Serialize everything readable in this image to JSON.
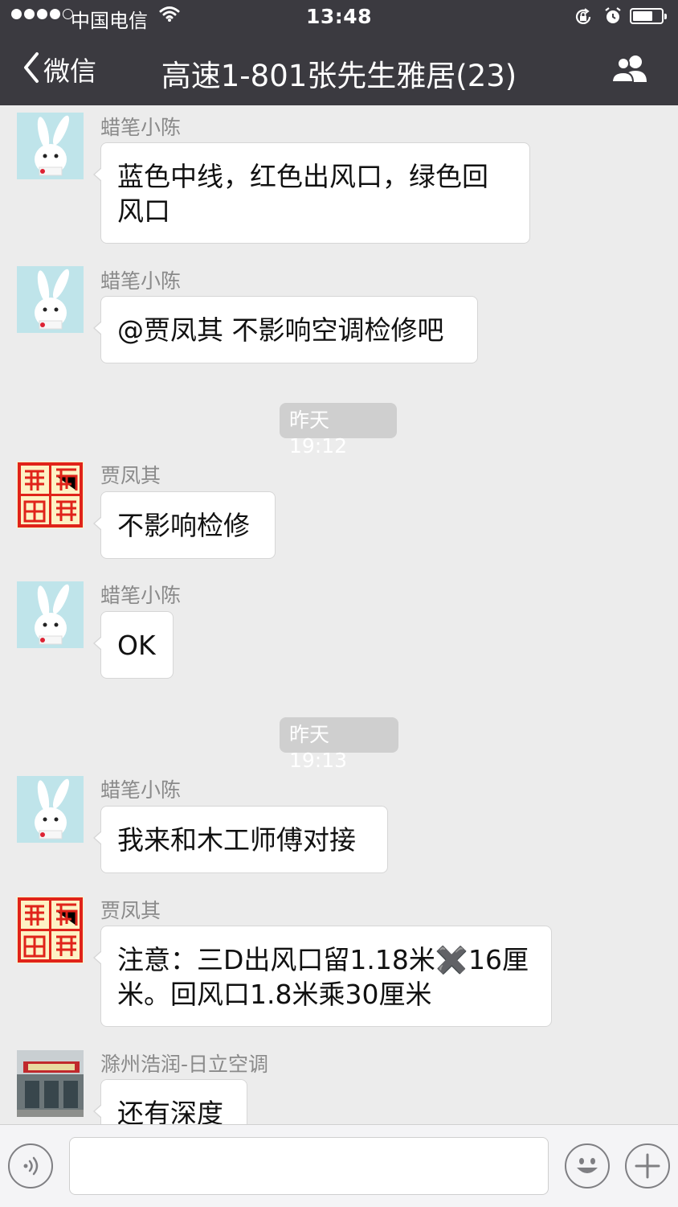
{
  "status_bar": {
    "carrier": "中国电信",
    "time": "13:48",
    "battery_level": 0.7
  },
  "nav": {
    "back_label": "微信",
    "title": "高速1-801张先生雅居(23)"
  },
  "messages": [
    {
      "sender": "蜡笔小陈",
      "avatar": "rabbit-avatar",
      "text": "蓝色中线，红色出风口，绿色回风口"
    },
    {
      "sender": "蜡笔小陈",
      "avatar": "rabbit-avatar",
      "text": "@贾凤其 不影响空调检修吧"
    },
    {
      "timestamp": "昨天 19:12"
    },
    {
      "sender": "贾凤其",
      "avatar": "seal-avatar",
      "text": "不影响检修"
    },
    {
      "sender": "蜡笔小陈",
      "avatar": "rabbit-avatar",
      "text": "OK"
    },
    {
      "timestamp": "昨天 19:13"
    },
    {
      "sender": "蜡笔小陈",
      "avatar": "rabbit-avatar",
      "text": "我来和木工师傅对接"
    },
    {
      "sender": "贾凤其",
      "avatar": "seal-avatar",
      "text": "注意：三D出风口留1.18米✖️16厘米。回风口1.8米乘30厘米"
    },
    {
      "sender": "滁州浩润-日立空调",
      "avatar": "storefront-avatar",
      "text": "还有深度"
    }
  ],
  "input_bar": {
    "voice_icon": "voice-icon",
    "emoji_icon": "emoji-icon",
    "plus_icon": "plus-icon"
  },
  "colors": {
    "header_bg": "#3b3a40",
    "chat_bg": "#ececec",
    "bubble_bg": "#ffffff",
    "timestamp_bg": "#cfcfcf",
    "sender_name": "#8a8a8a"
  }
}
